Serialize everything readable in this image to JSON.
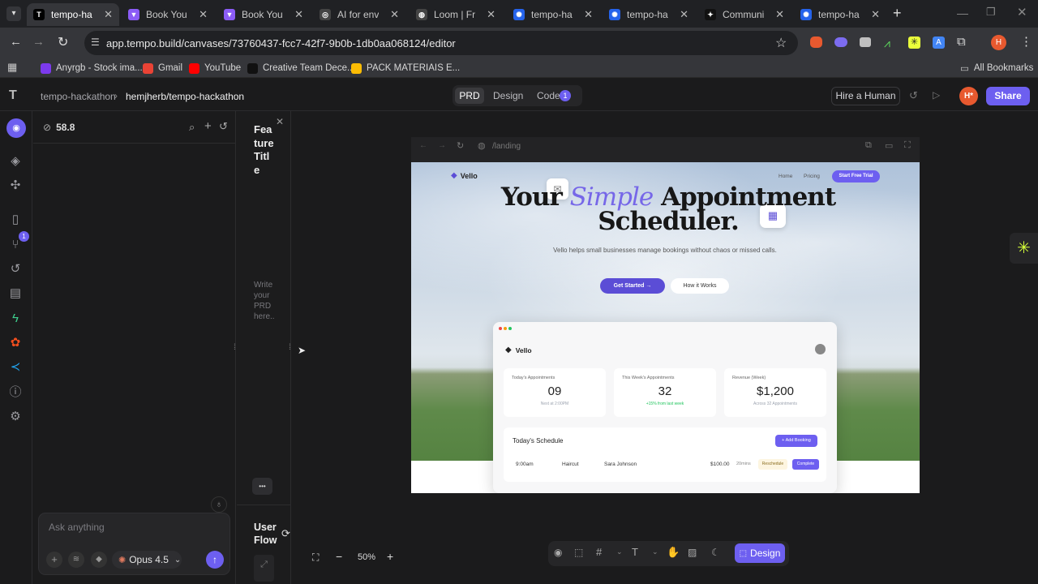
{
  "browser": {
    "tabs": [
      {
        "title": "tempo-hacka",
        "fav": "T",
        "color": "#000000",
        "active": true
      },
      {
        "title": "Book Your Ap",
        "fav": "▼",
        "color": "#8b5cf6"
      },
      {
        "title": "Book Your Ap",
        "fav": "▼",
        "color": "#8b5cf6"
      },
      {
        "title": "AI for enviro",
        "fav": "◎",
        "color": "#444444"
      },
      {
        "title": "Loom | Free S",
        "fav": "◍",
        "color": "#444444"
      },
      {
        "title": "tempo-hacka",
        "fav": "✺",
        "color": "#2563eb"
      },
      {
        "title": "tempo-hacka",
        "fav": "✺",
        "color": "#2563eb"
      },
      {
        "title": "Community p",
        "fav": "✦",
        "color": "#111111"
      },
      {
        "title": "tempo-hacka",
        "fav": "✺",
        "color": "#2563eb"
      }
    ],
    "url": "app.tempo.build/canvases/73760437-fcc7-42f7-9b0b-1db0aa068124/editor",
    "bookmarks": [
      {
        "label": "Anyrgb - Stock ima...",
        "color": "#7c3aed"
      },
      {
        "label": "Gmail",
        "color": "#ea4335"
      },
      {
        "label": "YouTube",
        "color": "#ff0000"
      },
      {
        "label": "Creative Team Dece...",
        "color": "#111111"
      },
      {
        "label": "PACK MATERIAIS E...",
        "color": "#fbbc04"
      }
    ],
    "all_bookmarks": "All Bookmarks",
    "profile_initial": "H"
  },
  "app": {
    "breadcrumb_root": "tempo-hackathon",
    "breadcrumb_sep": "›",
    "breadcrumb_project": "hemjherb/tempo-hackathon",
    "modes": [
      "PRD",
      "Design",
      "Code"
    ],
    "code_badge": "1",
    "hire_label": "Hire a Human",
    "avatar": "H*",
    "share_label": "Share",
    "rail_badge": "1"
  },
  "chat": {
    "credits": "58.8",
    "input_placeholder": "Ask anything",
    "model": "Opus 4.5"
  },
  "prd": {
    "feature_title": "Feature Title",
    "placeholder": "Write your PRD here..",
    "user_flow": "User Flow",
    "more": "•••"
  },
  "preview": {
    "url": "/landing",
    "brand": "Vello",
    "nav": [
      "Home",
      "Pricing"
    ],
    "trial_cta": "Start Free Trial",
    "headline_1": "Your",
    "headline_em": "Simple",
    "headline_2": "Appointment",
    "headline_3": "Scheduler.",
    "subtext": "Vello helps small businesses manage bookings without chaos or missed calls.",
    "cta_primary": "Get Started →",
    "cta_secondary": "How it Works",
    "dash": {
      "brand": "Vello",
      "stats": [
        {
          "label": "Today's Appointments",
          "value": "09",
          "sub": "Next at 2:00PM",
          "subcolor": "#9ca3af"
        },
        {
          "label": "This Week's Appointments",
          "value": "32",
          "sub": "+15% from last week",
          "subcolor": "#22c55e"
        },
        {
          "label": "Revenue (Week)",
          "value": "$1,200",
          "sub": "Across 32 Appointments",
          "subcolor": "#9ca3af"
        }
      ],
      "schedule_title": "Today's Schedule",
      "add_booking": "+ Add Booking",
      "row": {
        "time": "9:00am",
        "service": "Haircut",
        "client": "Sara Johnson",
        "price": "$100.00",
        "duration": "20mins",
        "reschedule": "Reschedule",
        "complete": "Complete"
      }
    }
  },
  "canvas_toolbar": {
    "zoom": "50%",
    "design_label": "Design"
  }
}
